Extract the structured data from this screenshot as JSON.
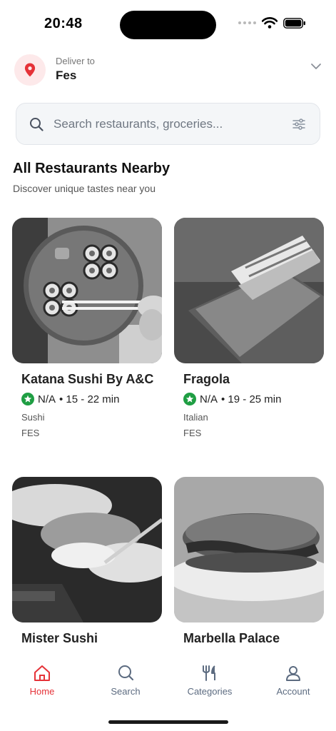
{
  "status_bar": {
    "time": "20:48"
  },
  "header": {
    "deliver_label": "Deliver to",
    "city": "Fes"
  },
  "search": {
    "placeholder": "Search restaurants, groceries..."
  },
  "section": {
    "title": "All Restaurants Nearby",
    "subtitle": "Discover unique tastes near you"
  },
  "restaurants": [
    {
      "name": "Katana Sushi By A&C",
      "rating": "N/A",
      "time": "• 15 - 22 min",
      "cuisine": "Sushi",
      "city": "FES"
    },
    {
      "name": "Fragola",
      "rating": "N/A",
      "time": "• 19 - 25 min",
      "cuisine": "Italian",
      "city": "FES"
    },
    {
      "name": "Mister Sushi"
    },
    {
      "name": "Marbella Palace"
    }
  ],
  "tabs": [
    {
      "label": "Home",
      "icon": "home-icon",
      "active": true
    },
    {
      "label": "Search",
      "icon": "search-icon",
      "active": false
    },
    {
      "label": "Categories",
      "icon": "fork-knife-icon",
      "active": false
    },
    {
      "label": "Account",
      "icon": "user-icon",
      "active": false
    }
  ],
  "colors": {
    "accent": "#e53238",
    "rating_green": "#1f9e43",
    "tab_inactive": "#5c6b80",
    "location_badge_bg": "#fde9ea"
  }
}
